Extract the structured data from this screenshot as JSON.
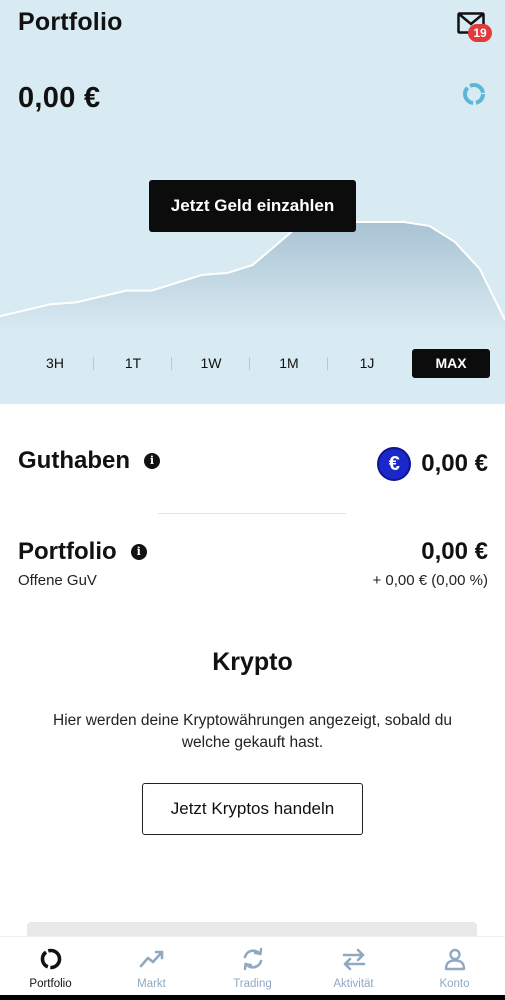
{
  "header": {
    "title": "Portfolio",
    "notification_count": "19",
    "balance": "0,00 €"
  },
  "chart_data": {
    "type": "area",
    "title": "",
    "xlabel": "",
    "ylabel": "",
    "x": [
      0,
      1,
      2,
      3,
      4,
      5,
      6,
      7,
      8,
      9,
      10,
      11,
      12,
      13,
      14,
      15,
      16,
      17,
      18,
      19,
      20
    ],
    "series": [
      {
        "values": [
          2,
          5,
          8,
          9,
          12,
          15,
          15,
          19,
          23,
          24,
          28,
          39,
          50,
          50,
          50,
          50,
          50,
          48,
          40,
          26,
          0
        ]
      }
    ],
    "grid": false,
    "legend": "none"
  },
  "chart": {
    "cta_label": "Jetzt Geld einzahlen",
    "ranges": [
      "3H",
      "1T",
      "1W",
      "1M",
      "1J",
      "MAX"
    ],
    "active_range": "MAX"
  },
  "guthaben": {
    "label": "Guthaben",
    "currency_symbol": "€",
    "value": "0,00 €"
  },
  "portfolio": {
    "label": "Portfolio",
    "value": "0,00 €",
    "sub_label": "Offene GuV",
    "sub_value": "+ 0,00 € (0,00 %)"
  },
  "krypto": {
    "title": "Krypto",
    "text": "Hier werden deine Kryptowährungen angezeigt, sobald du welche gekauft hast.",
    "button_label": "Jetzt Kryptos handeln"
  },
  "nav": {
    "items": [
      {
        "label": "Portfolio",
        "icon": "portfolio-pie-icon",
        "active": true
      },
      {
        "label": "Markt",
        "icon": "trend-up-icon",
        "active": false
      },
      {
        "label": "Trading",
        "icon": "refresh-icon",
        "active": false
      },
      {
        "label": "Aktivität",
        "icon": "swap-arrows-icon",
        "active": false
      },
      {
        "label": "Konto",
        "icon": "user-icon",
        "active": false
      }
    ]
  },
  "colors": {
    "hero_bg": "#d8eaf2",
    "accent_blue": "#1b27c9",
    "badge_red": "#e03a3e",
    "nav_inactive": "#8fa9c1"
  }
}
